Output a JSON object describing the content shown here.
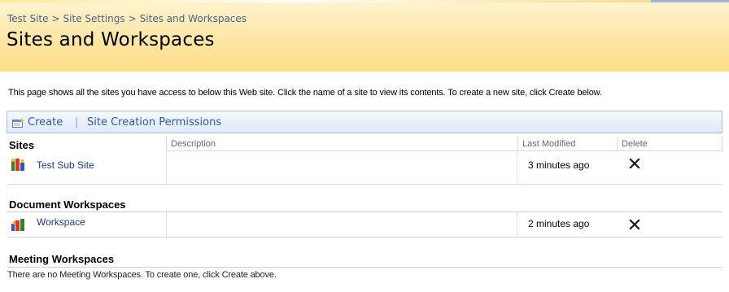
{
  "breadcrumb": [
    "Test Site",
    "Site Settings",
    "Sites and Workspaces"
  ],
  "breadcrumb_separator": ">",
  "page_title": "Sites and Workspaces",
  "description": "This page shows all the sites you have access to below this Web site. Click the name of a site to view its contents. To create a new site, click Create below.",
  "toolbar": {
    "create_label": "Create",
    "divider": "|",
    "permissions_label": "Site Creation Permissions"
  },
  "table": {
    "columns": {
      "description": "Description",
      "last_modified": "Last Modified",
      "delete": "Delete"
    },
    "sections": [
      {
        "label": "Sites",
        "rows": [
          {
            "name": "Test Sub Site",
            "modified": "3 minutes ago",
            "icon": "site-icon"
          }
        ]
      },
      {
        "label": "Document Workspaces",
        "rows": [
          {
            "name": "Workspace",
            "modified": "2 minutes ago",
            "icon": "document-workspace-icon"
          }
        ]
      },
      {
        "label": "Meeting Workspaces",
        "empty_message": "There are no Meeting Workspaces. To create one, click Create above."
      }
    ]
  },
  "colors": {
    "header_gradient_top": "#fff4cf",
    "header_gradient_bottom": "#fbdc86",
    "link": "#3656a4",
    "toolbar_border": "#a6c0e6"
  }
}
